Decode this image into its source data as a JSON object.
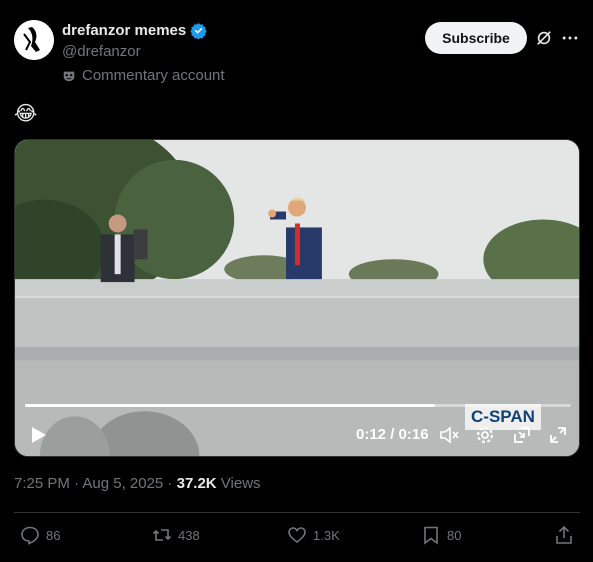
{
  "author": {
    "display_name": "drefanzor memes",
    "handle": "@drefanzor",
    "label": "Commentary account"
  },
  "header": {
    "subscribe_label": "Subscribe"
  },
  "post": {
    "text": "😂"
  },
  "video": {
    "time_display": "0:12 / 0:16",
    "progress": 0.75,
    "watermark": "C-SPAN"
  },
  "meta": {
    "timestamp": "7:25 PM · Aug 5, 2025 · ",
    "views_count": "37.2K",
    "views_label": " Views"
  },
  "actions": {
    "replies": "86",
    "reposts": "438",
    "likes": "1.3K",
    "bookmarks": "80"
  },
  "colors": {
    "background": "#000000",
    "text_primary": "#e7e9ea",
    "text_secondary": "#71767b",
    "verified": "#1d9bf0",
    "divider": "#2f3336",
    "subscribe_bg": "#eff3f4"
  }
}
